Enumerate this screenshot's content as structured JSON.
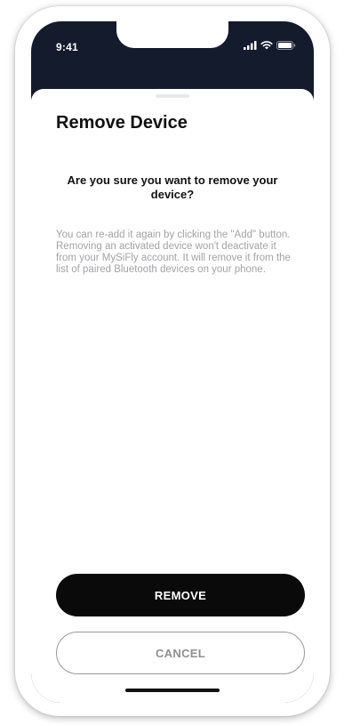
{
  "status_bar": {
    "time": "9:41",
    "icons": [
      "cellular-signal-icon",
      "wifi-icon",
      "battery-icon"
    ]
  },
  "sheet": {
    "title": "Remove Device",
    "question": "Are you sure you want to remove your device?",
    "explanation": "You can re-add it again by clicking the \"Add\" button. Removing an activated device won't deactivate it from your MySiFly account. It will remove it from the list of paired Bluetooth devices on your phone."
  },
  "buttons": {
    "remove_label": "REMOVE",
    "cancel_label": "CANCEL"
  },
  "colors": {
    "header_background": "#141b2d",
    "primary_button": "#0a0a0a",
    "secondary_text": "#a3a3a7"
  }
}
